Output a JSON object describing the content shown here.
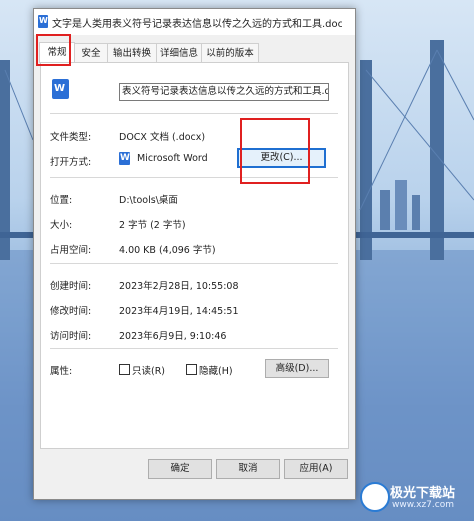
{
  "window": {
    "title": "文字是人类用表义符号记录表达信息以传之久远的方式和工具.docx 属性"
  },
  "tabs": [
    {
      "label": "常规"
    },
    {
      "label": "安全"
    },
    {
      "label": "输出转换"
    },
    {
      "label": "详细信息"
    },
    {
      "label": "以前的版本"
    }
  ],
  "general": {
    "file_name": "表义符号记录表达信息以传之久远的方式和工具.docx",
    "file_type_label": "文件类型:",
    "file_type_value": "DOCX 文档 (.docx)",
    "open_with_label": "打开方式:",
    "open_with_value": "Microsoft Word",
    "change_button": "更改(C)...",
    "location_label": "位置:",
    "location_value": "D:\\tools\\桌面",
    "size_label": "大小:",
    "size_value": "2 字节 (2 字节)",
    "disk_size_label": "占用空间:",
    "disk_size_value": "4.00 KB (4,096 字节)",
    "created_label": "创建时间:",
    "created_value": "2023年2月28日, 10:55:08",
    "modified_label": "修改时间:",
    "modified_value": "2023年4月19日, 14:45:51",
    "accessed_label": "访问时间:",
    "accessed_value": "2023年6月9日, 9:10:46",
    "attributes_label": "属性:",
    "readonly_label": "只读(R)",
    "hidden_label": "隐藏(H)",
    "advanced_button": "高级(D)..."
  },
  "footer": {
    "ok": "确定",
    "cancel": "取消",
    "apply": "应用(A)"
  },
  "watermark": {
    "line1": "极光下载站",
    "line2": "www.xz7.com"
  },
  "icons": {
    "doc_icon": "W",
    "word_icon": "W"
  },
  "colors": {
    "accent": "#1f6fd1",
    "highlight": "#e02020"
  }
}
